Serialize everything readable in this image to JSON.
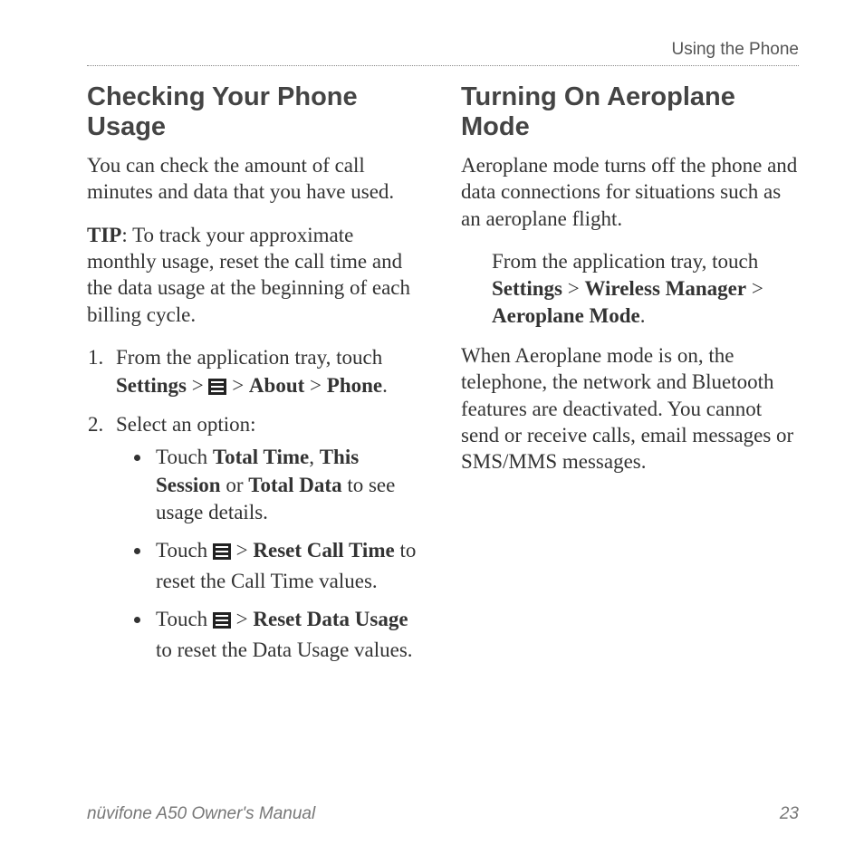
{
  "header": "Using the Phone",
  "left": {
    "heading": "Checking Your Phone Usage",
    "intro": "You can check the amount of call minutes and data that you have used.",
    "tip_label": "TIP",
    "tip_text": ": To track your approximate monthly usage, reset the call time and the data usage at the beginning of each billing cycle.",
    "step1_pre": "From the application tray, touch ",
    "step1_b1": "Settings",
    "step1_sep1": " > ",
    "step1_sep2": " > ",
    "step1_b2": "About",
    "step1_sep3": " > ",
    "step1_b3": "Phone",
    "step1_end": ".",
    "step2": "Select an option:",
    "b1_pre": "Touch ",
    "b1_b1": "Total Time",
    "b1_sep1": ", ",
    "b1_b2": "This Session",
    "b1_sep2": " or ",
    "b1_b3": "Total Data",
    "b1_post": " to see usage details.",
    "b2_pre": "Touch ",
    "b2_sep": " > ",
    "b2_b1": "Reset Call Time",
    "b2_post": " to reset the Call Time values.",
    "b3_pre": "Touch ",
    "b3_sep": " > ",
    "b3_b1": "Reset Data Usage",
    "b3_post": " to reset the Data Usage values."
  },
  "right": {
    "heading": "Turning On Aeroplane Mode",
    "intro": "Aeroplane mode turns off the phone and data connections for situations such as an aeroplane flight.",
    "step_pre": "From the application tray, touch ",
    "step_b1": "Settings",
    "step_sep1": " > ",
    "step_b2": "Wireless Manager",
    "step_sep2": " > ",
    "step_b3": "Aeroplane Mode",
    "step_end": ".",
    "outro": "When Aeroplane mode is on, the telephone, the network and Bluetooth features are deactivated. You cannot send or receive calls, email messages or SMS/MMS messages."
  },
  "footer": {
    "manual": "nüvifone A50 Owner's Manual",
    "page": "23"
  }
}
